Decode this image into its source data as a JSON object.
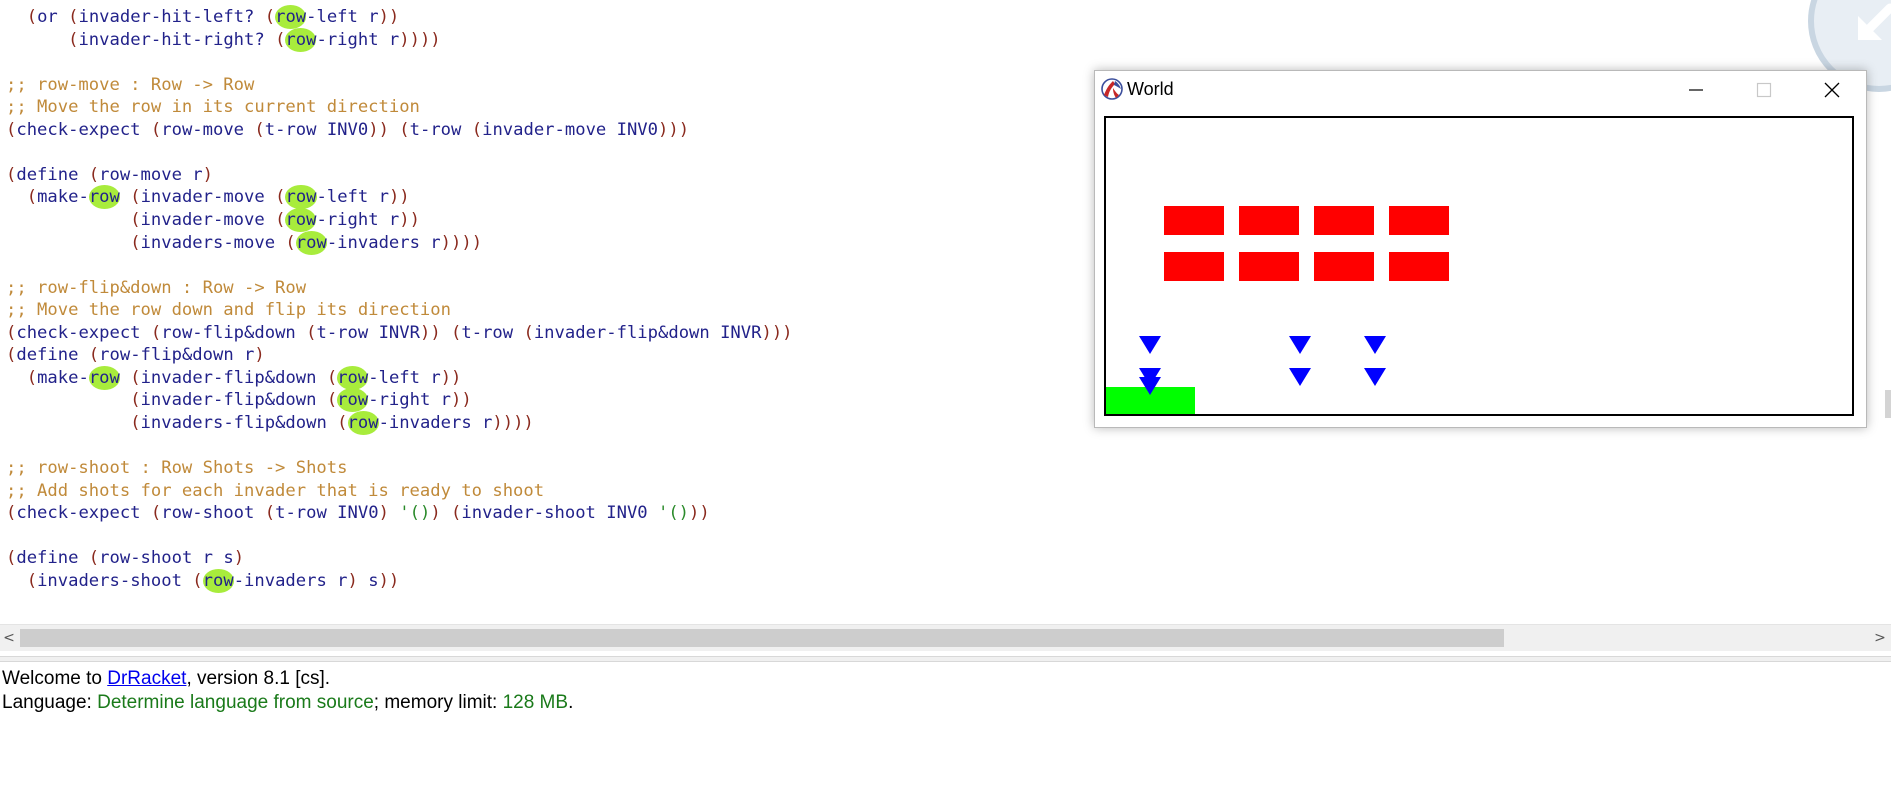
{
  "editor": {
    "lines": [
      [
        {
          "t": "  ",
          "c": ""
        },
        {
          "t": "(",
          "c": "t-paren"
        },
        {
          "t": "or ",
          "c": "t-kw"
        },
        {
          "t": "(",
          "c": "t-paren"
        },
        {
          "t": "invader-hit-left? ",
          "c": "t-kw"
        },
        {
          "t": "(",
          "c": "t-paren"
        },
        {
          "t": "row",
          "c": "t-hl"
        },
        {
          "t": "-left r",
          "c": "t-kw"
        },
        {
          "t": "))",
          "c": "t-paren"
        }
      ],
      [
        {
          "t": "      ",
          "c": ""
        },
        {
          "t": "(",
          "c": "t-paren"
        },
        {
          "t": "invader-hit-right? ",
          "c": "t-kw"
        },
        {
          "t": "(",
          "c": "t-paren"
        },
        {
          "t": "row",
          "c": "t-hl"
        },
        {
          "t": "-right r",
          "c": "t-kw"
        },
        {
          "t": "))))",
          "c": "t-paren"
        }
      ],
      [],
      [
        {
          "t": ";; row-move : Row -> Row",
          "c": "t-comment"
        }
      ],
      [
        {
          "t": ";; Move the row in its current direction",
          "c": "t-comment"
        }
      ],
      [
        {
          "t": "(",
          "c": "t-paren"
        },
        {
          "t": "check-expect ",
          "c": "t-kw"
        },
        {
          "t": "(",
          "c": "t-paren"
        },
        {
          "t": "row-move ",
          "c": "t-kw"
        },
        {
          "t": "(",
          "c": "t-paren"
        },
        {
          "t": "t-row INV0",
          "c": "t-kw"
        },
        {
          "t": ")) (",
          "c": "t-paren"
        },
        {
          "t": "t-row ",
          "c": "t-kw"
        },
        {
          "t": "(",
          "c": "t-paren"
        },
        {
          "t": "invader-move INV0",
          "c": "t-kw"
        },
        {
          "t": ")))",
          "c": "t-paren"
        }
      ],
      [],
      [
        {
          "t": "(",
          "c": "t-paren"
        },
        {
          "t": "define ",
          "c": "t-kw"
        },
        {
          "t": "(",
          "c": "t-paren"
        },
        {
          "t": "row-move r",
          "c": "t-kw"
        },
        {
          "t": ")",
          "c": "t-paren"
        }
      ],
      [
        {
          "t": "  ",
          "c": ""
        },
        {
          "t": "(",
          "c": "t-paren"
        },
        {
          "t": "make-",
          "c": "t-kw"
        },
        {
          "t": "row",
          "c": "t-hl"
        },
        {
          "t": " ",
          "c": ""
        },
        {
          "t": "(",
          "c": "t-paren"
        },
        {
          "t": "invader-move ",
          "c": "t-kw"
        },
        {
          "t": "(",
          "c": "t-paren"
        },
        {
          "t": "row",
          "c": "t-hl"
        },
        {
          "t": "-left r",
          "c": "t-kw"
        },
        {
          "t": "))",
          "c": "t-paren"
        }
      ],
      [
        {
          "t": "            ",
          "c": ""
        },
        {
          "t": "(",
          "c": "t-paren"
        },
        {
          "t": "invader-move ",
          "c": "t-kw"
        },
        {
          "t": "(",
          "c": "t-paren"
        },
        {
          "t": "row",
          "c": "t-hl"
        },
        {
          "t": "-right r",
          "c": "t-kw"
        },
        {
          "t": "))",
          "c": "t-paren"
        }
      ],
      [
        {
          "t": "            ",
          "c": ""
        },
        {
          "t": "(",
          "c": "t-paren"
        },
        {
          "t": "invaders-move ",
          "c": "t-kw"
        },
        {
          "t": "(",
          "c": "t-paren"
        },
        {
          "t": "row",
          "c": "t-hl"
        },
        {
          "t": "-invaders r",
          "c": "t-kw"
        },
        {
          "t": "))))",
          "c": "t-paren"
        }
      ],
      [],
      [
        {
          "t": ";; row-flip&down : Row -> Row",
          "c": "t-comment"
        }
      ],
      [
        {
          "t": ";; Move the row down and flip its direction",
          "c": "t-comment"
        }
      ],
      [
        {
          "t": "(",
          "c": "t-paren"
        },
        {
          "t": "check-expect ",
          "c": "t-kw"
        },
        {
          "t": "(",
          "c": "t-paren"
        },
        {
          "t": "row-flip&down ",
          "c": "t-kw"
        },
        {
          "t": "(",
          "c": "t-paren"
        },
        {
          "t": "t-row INVR",
          "c": "t-kw"
        },
        {
          "t": ")) (",
          "c": "t-paren"
        },
        {
          "t": "t-row ",
          "c": "t-kw"
        },
        {
          "t": "(",
          "c": "t-paren"
        },
        {
          "t": "invader-flip&down INVR",
          "c": "t-kw"
        },
        {
          "t": ")))",
          "c": "t-paren"
        }
      ],
      [
        {
          "t": "(",
          "c": "t-paren"
        },
        {
          "t": "define ",
          "c": "t-kw"
        },
        {
          "t": "(",
          "c": "t-paren"
        },
        {
          "t": "row-flip&down r",
          "c": "t-kw"
        },
        {
          "t": ")",
          "c": "t-paren"
        }
      ],
      [
        {
          "t": "  ",
          "c": ""
        },
        {
          "t": "(",
          "c": "t-paren"
        },
        {
          "t": "make-",
          "c": "t-kw"
        },
        {
          "t": "row",
          "c": "t-hl"
        },
        {
          "t": " ",
          "c": ""
        },
        {
          "t": "(",
          "c": "t-paren"
        },
        {
          "t": "invader-flip&down ",
          "c": "t-kw"
        },
        {
          "t": "(",
          "c": "t-paren"
        },
        {
          "t": "row",
          "c": "t-hl"
        },
        {
          "t": "-left r",
          "c": "t-kw"
        },
        {
          "t": "))",
          "c": "t-paren"
        }
      ],
      [
        {
          "t": "            ",
          "c": ""
        },
        {
          "t": "(",
          "c": "t-paren"
        },
        {
          "t": "invader-flip&down ",
          "c": "t-kw"
        },
        {
          "t": "(",
          "c": "t-paren"
        },
        {
          "t": "row",
          "c": "t-hl"
        },
        {
          "t": "-right r",
          "c": "t-kw"
        },
        {
          "t": "))",
          "c": "t-paren"
        }
      ],
      [
        {
          "t": "            ",
          "c": ""
        },
        {
          "t": "(",
          "c": "t-paren"
        },
        {
          "t": "invaders-flip&down ",
          "c": "t-kw"
        },
        {
          "t": "(",
          "c": "t-paren"
        },
        {
          "t": "row",
          "c": "t-hl"
        },
        {
          "t": "-invaders r",
          "c": "t-kw"
        },
        {
          "t": "))))",
          "c": "t-paren"
        }
      ],
      [],
      [
        {
          "t": ";; row-shoot : Row Shots -> Shots",
          "c": "t-comment"
        }
      ],
      [
        {
          "t": ";; Add shots for each invader that is ready to shoot",
          "c": "t-comment"
        }
      ],
      [
        {
          "t": "(",
          "c": "t-paren"
        },
        {
          "t": "check-expect ",
          "c": "t-kw"
        },
        {
          "t": "(",
          "c": "t-paren"
        },
        {
          "t": "row-shoot ",
          "c": "t-kw"
        },
        {
          "t": "(",
          "c": "t-paren"
        },
        {
          "t": "t-row INV0",
          "c": "t-kw"
        },
        {
          "t": ") ",
          "c": "t-paren"
        },
        {
          "t": "'()",
          "c": "t-quote"
        },
        {
          "t": ") (",
          "c": "t-paren"
        },
        {
          "t": "invader-shoot INV0 ",
          "c": "t-kw"
        },
        {
          "t": "'()",
          "c": "t-quote"
        },
        {
          "t": "))",
          "c": "t-paren"
        }
      ],
      [],
      [
        {
          "t": "(",
          "c": "t-paren"
        },
        {
          "t": "define ",
          "c": "t-kw"
        },
        {
          "t": "(",
          "c": "t-paren"
        },
        {
          "t": "row-shoot r s",
          "c": "t-kw"
        },
        {
          "t": ")",
          "c": "t-paren"
        }
      ],
      [
        {
          "t": "  ",
          "c": ""
        },
        {
          "t": "(",
          "c": "t-paren"
        },
        {
          "t": "invaders-shoot ",
          "c": "t-kw"
        },
        {
          "t": "(",
          "c": "t-paren"
        },
        {
          "t": "row",
          "c": "t-hl"
        },
        {
          "t": "-invaders r",
          "c": "t-kw"
        },
        {
          "t": ") ",
          "c": "t-paren"
        },
        {
          "t": "s",
          "c": "t-kw"
        },
        {
          "t": "))",
          "c": "t-paren"
        }
      ]
    ]
  },
  "scrollbar": {
    "left_arrow": "<",
    "right_arrow": ">"
  },
  "repl": {
    "line1_prefix": "Welcome to ",
    "line1_link": "DrRacket",
    "line1_suffix": ", version 8.1 [cs].",
    "line2_prefix": "Language: ",
    "line2_language": "Determine language from source",
    "line2_mid": "; memory limit: ",
    "line2_memory": "128 MB",
    "line2_end": "."
  },
  "world": {
    "title": "World",
    "colors": {
      "invader": "#ff0000",
      "shot": "#0000ff",
      "player": "#00ff00"
    },
    "invader_rows": 2,
    "invader_cols": 4,
    "shot_count": 7
  }
}
